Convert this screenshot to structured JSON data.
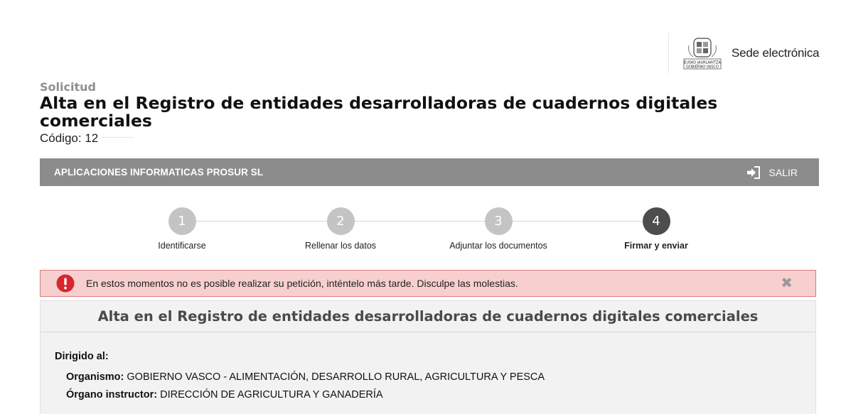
{
  "brand": {
    "logo_text_line1": "EUSKO JAURLARITZA",
    "logo_text_line2": "GOBIERNO VASCO",
    "site_name": "Sede electrónica"
  },
  "page": {
    "kicker": "Solicitud",
    "title": "Alta en el Registro de entidades desarrolladoras de cuadernos digitales comerciales",
    "code_label": "Código: 12"
  },
  "bar": {
    "company": "APLICACIONES INFORMATICAS PROSUR SL",
    "logout_label": "SALIR",
    "logout_icon": "sign-out-icon"
  },
  "steps": [
    {
      "number": "1",
      "label": "Identificarse",
      "active": false
    },
    {
      "number": "2",
      "label": "Rellenar los datos",
      "active": false
    },
    {
      "number": "3",
      "label": "Adjuntar los documentos",
      "active": false
    },
    {
      "number": "4",
      "label": "Firmar y enviar",
      "active": true
    }
  ],
  "alert": {
    "icon": "exclamation-circle-icon",
    "message": "En estos momentos no es posible realizar su petición, inténtelo más tarde. Disculpe las molestias.",
    "close": "✖"
  },
  "panel": {
    "title": "Alta en el Registro de entidades desarrolladoras de cuadernos digitales comerciales",
    "directed_label": "Dirigido al:",
    "organismo_label": "Organismo:",
    "organismo_value": "GOBIERNO VASCO - ALIMENTACIÓN, DESARROLLO RURAL, AGRICULTURA Y PESCA",
    "organo_label": "Órgano instructor:",
    "organo_value": "DIRECCIÓN DE AGRICULTURA Y GANADERÍA"
  },
  "colors": {
    "bar": "#8c8c8c",
    "step_inactive": "#c4c4c4",
    "step_active": "#4d4d4d",
    "alert_bg": "#f7cfcf",
    "alert_border": "#e07b7b",
    "alert_icon": "#d9262c"
  }
}
